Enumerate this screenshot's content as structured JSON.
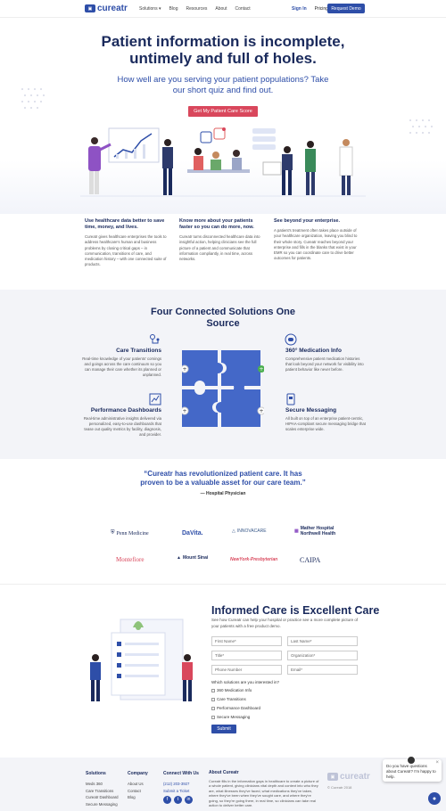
{
  "nav": {
    "logo_text": "cureatr",
    "links": [
      "Solutions ▾",
      "Blog",
      "Resources",
      "About",
      "Contact"
    ],
    "signin": "Sign In",
    "pricing": "Pricing",
    "demo": "Request Demo"
  },
  "hero": {
    "title": "Patient information is incomplete, untimely and full of holes.",
    "subtitle": "How well are you serving your patient populations? Take our short quiz and find out.",
    "cta": "Get My Patient Care Score"
  },
  "features": [
    {
      "title": "Use healthcare data better to save time, money, and lives.",
      "body": "Cureatr gives healthcare enterprises the tools to address healthcare's human and business problems by closing critical gaps – in communication, transitions of care, and medication history – with one connected suite of products."
    },
    {
      "title": "Know more about your patients faster so you can do more, now.",
      "body": "Cureatr turns disconnected healthcare data into insightful action, helping clinicians see the full picture of a patient and communicate that information compliantly, in real time, across networks."
    },
    {
      "title": "See beyond your enterprise.",
      "body": "A patient's treatment often takes place outside of your healthcare organization, leaving you blind to their whole story. Cureatr reaches beyond your enterprise and fills in the blanks that exist in your EMR so you can coordinate care to drive better outcomes for patients."
    }
  ],
  "solutions": {
    "title": "Four Connected Solutions One Source",
    "items": [
      {
        "title": "Care Transitions",
        "body": "Real-time knowledge of your patients' comings and goings across the care continuum so you can manage their care whether its planned or unplanned."
      },
      {
        "title": "360° Medication Info",
        "body": "Comprehensive patient medication histories that look beyond your network for visibility into patient behavior like never before."
      },
      {
        "title": "Performance Dashboards",
        "body": "Real-time administrative insights delivered via personalized, easy-to-use dashboards that tease out quality metrics by facility, diagnosis, and provider."
      },
      {
        "title": "Secure Messaging",
        "body": "All built on top of an enterprise patient-centric, HIPAA-compliant secure messaging bridge that scales enterprise wide."
      }
    ]
  },
  "quote": {
    "text": "“Cureatr has revolutionized patient care. It has proven to be a valuable asset for our care team.”",
    "by": "— Hospital Physician"
  },
  "logos": [
    "Penn Medicine",
    "DaVita.",
    "INNOVACARE",
    "Mather Hospital Northwell Health",
    "Montefiore",
    "Mount Sinai",
    "NewYork-Presbyterian",
    "CAIPA"
  ],
  "informed": {
    "title": "Informed Care is Excellent Care",
    "text": "See how Cureatr can help your hospital or practice see a more complete picture of your patients with a free product demo.",
    "fields": [
      "First Name*",
      "Last Name*",
      "Title*",
      "Organization*",
      "Phone Number",
      "Email*"
    ],
    "question": "Which solutions are you interested in?",
    "options": [
      "360 Medication Info",
      "Care Transitions",
      "Performance Dashboard",
      "Secure Messaging"
    ],
    "submit": "Submit"
  },
  "footer": {
    "solutions_title": "Solutions",
    "solutions": [
      "Meds 360",
      "Care Transitions",
      "Cureatr Dashboard",
      "Secure Messaging"
    ],
    "company_title": "Company",
    "company": [
      "About Us",
      "Contact",
      "Blog"
    ],
    "connect_title": "Connect With Us",
    "phone": "(212) 203-3927",
    "ticket": "Submit a Ticket",
    "about_title": "About Cureatr",
    "about_text": "Cureatr fills in the information gaps in healthcare to create a picture of a whole patient, giving clinicians vital depth and context into who they are, what illnesses they've faced, what medications they've taken, where they've been when they've sought care, and where they're going, so they're going there, in real time, so clinicians can take real action to deliver better care.",
    "logo_text": "cureatr",
    "copyright": "© Cureatr 2018"
  },
  "chat": {
    "text": "Do you have questions about Cureatr? I'm happy to help.",
    "close": "×"
  },
  "colors": {
    "brand": "#2e4ea8",
    "cta": "#d9475c",
    "navy": "#1a2a5c"
  }
}
